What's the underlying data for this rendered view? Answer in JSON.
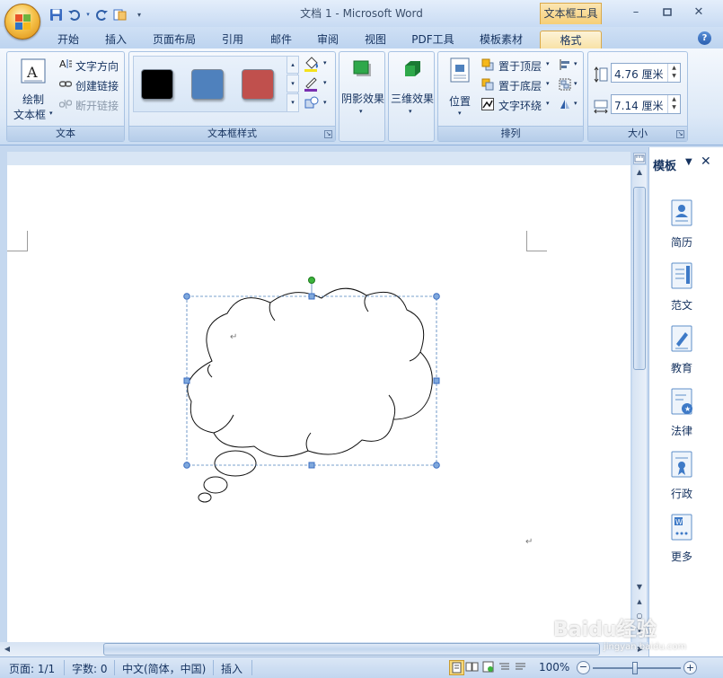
{
  "app": {
    "title": "文档 1 - Microsoft Word",
    "context_tool": "文本框工具"
  },
  "tabs": [
    {
      "label": "开始"
    },
    {
      "label": "插入"
    },
    {
      "label": "页面布局"
    },
    {
      "label": "引用"
    },
    {
      "label": "邮件"
    },
    {
      "label": "审阅"
    },
    {
      "label": "视图"
    },
    {
      "label": "PDF工具"
    },
    {
      "label": "模板素材"
    },
    {
      "label": "格式",
      "active": true
    }
  ],
  "ribbon": {
    "text_group": {
      "label": "文本",
      "draw_textbox_line1": "绘制",
      "draw_textbox_line2": "文本框",
      "text_direction": "文字方向",
      "create_link": "创建链接",
      "break_link": "断开链接"
    },
    "styles_group": {
      "label": "文本框样式",
      "swatches": [
        "#000000",
        "#4f81bd",
        "#c0504d"
      ]
    },
    "shadow_group": {
      "label": "阴影效果"
    },
    "threed_group": {
      "label": "三维效果"
    },
    "arrange_group": {
      "label": "排列",
      "position": "位置",
      "bring_front": "置于顶层",
      "send_back": "置于底层",
      "text_wrap": "文字环绕"
    },
    "size_group": {
      "label": "大小",
      "height": "4.76 厘米",
      "width": "7.14 厘米"
    }
  },
  "pane": {
    "title": "模板",
    "items": [
      {
        "label": "简历",
        "icon": "resume-icon"
      },
      {
        "label": "范文",
        "icon": "sample-doc-icon"
      },
      {
        "label": "教育",
        "icon": "education-icon"
      },
      {
        "label": "法律",
        "icon": "law-icon"
      },
      {
        "label": "行政",
        "icon": "admin-icon"
      },
      {
        "label": "更多",
        "icon": "more-icon"
      }
    ]
  },
  "status": {
    "page": "页面: 1/1",
    "words": "字数: 0",
    "language": "中文(简体，中国)",
    "mode": "插入",
    "zoom": "100%"
  },
  "colors": {
    "accent": "#c5d8ef",
    "context_tab": "#f6cf77",
    "selection_handle": "#4f81bd",
    "rotate_handle": "#3cb43c"
  },
  "watermark": {
    "text": "Baidu经验",
    "url": "jingyan.baidu.com"
  }
}
